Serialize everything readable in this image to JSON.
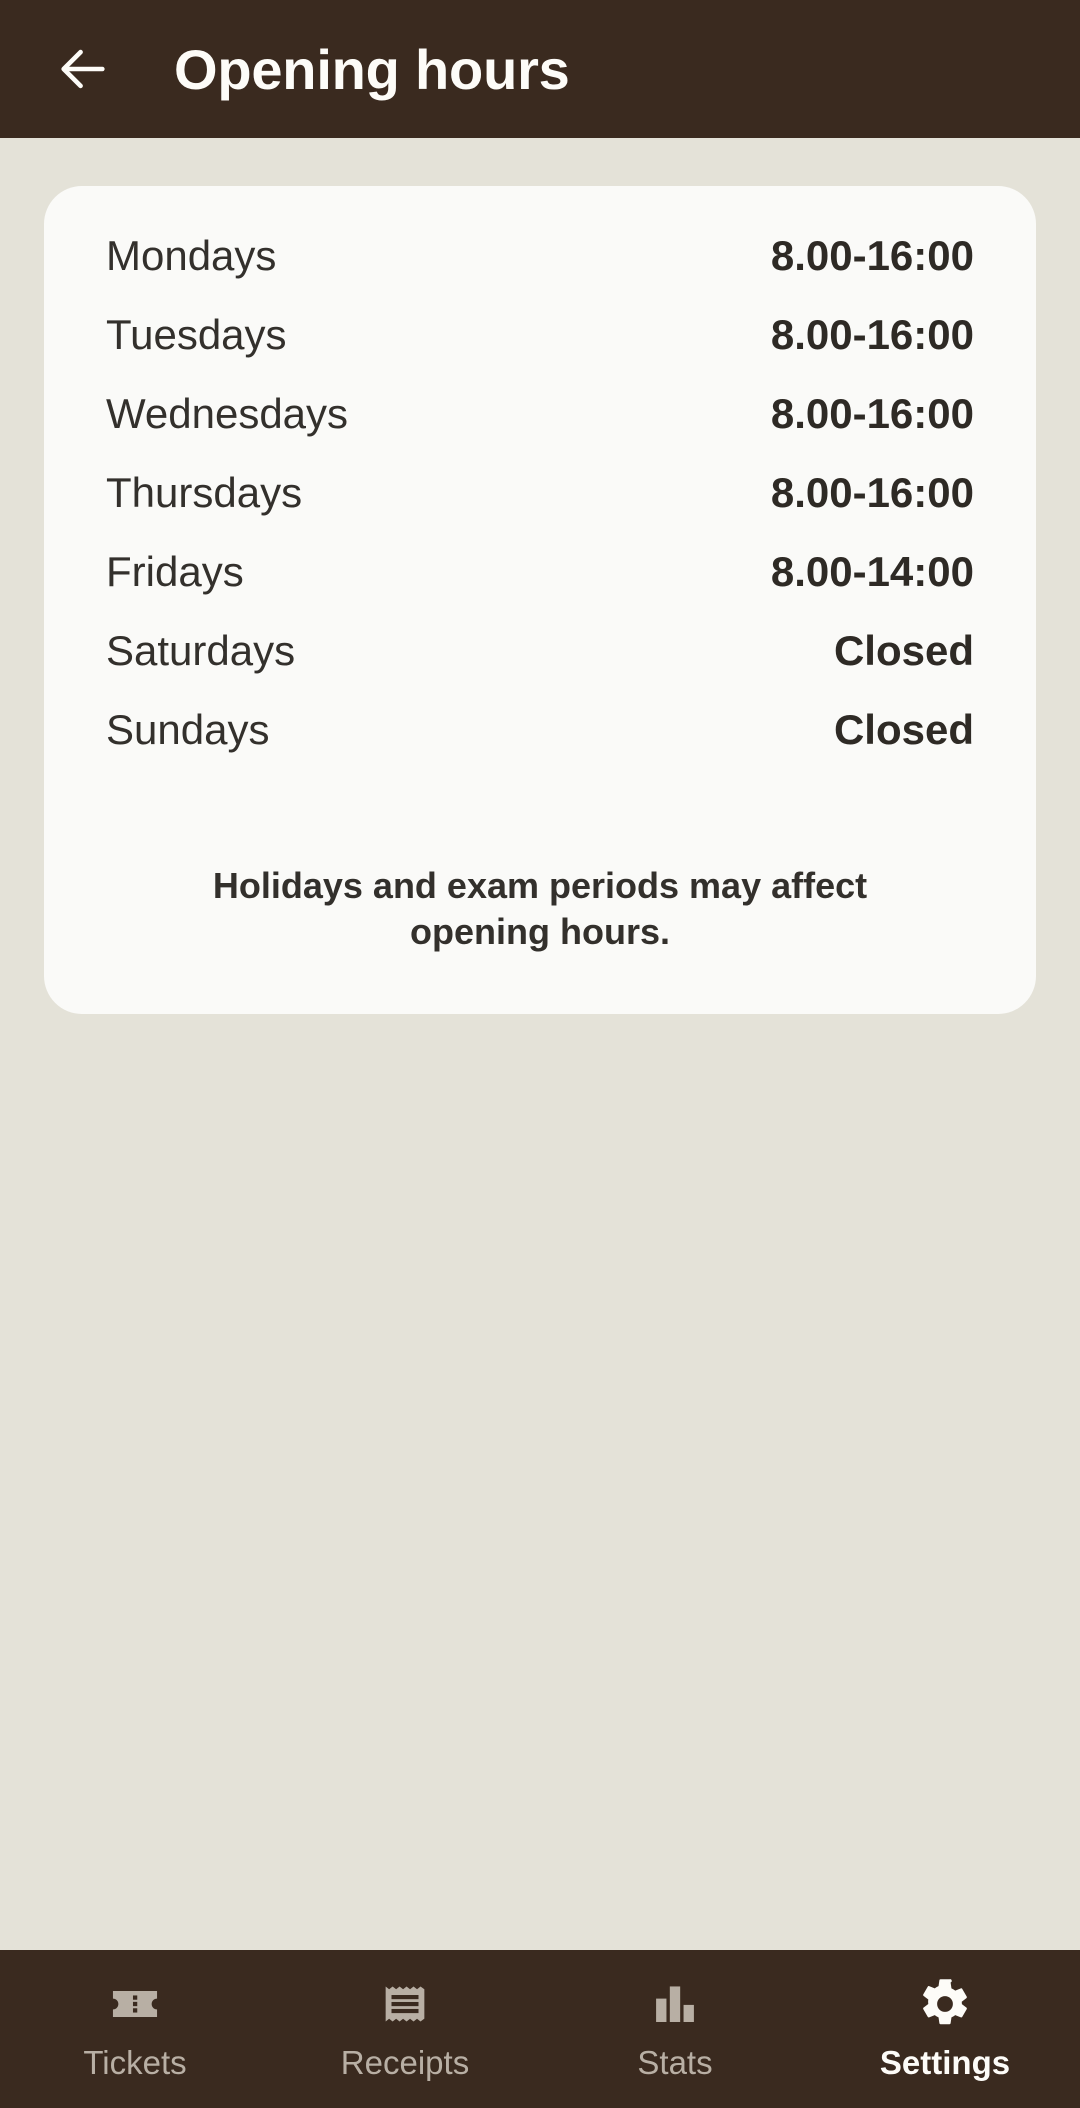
{
  "appbar": {
    "back_icon": "arrow-left-icon",
    "title": "Opening hours"
  },
  "card": {
    "rows": [
      {
        "day": "Mondays",
        "hours": "8.00-16:00"
      },
      {
        "day": "Tuesdays",
        "hours": "8.00-16:00"
      },
      {
        "day": "Wednesdays",
        "hours": "8.00-16:00"
      },
      {
        "day": "Thursdays",
        "hours": "8.00-16:00"
      },
      {
        "day": "Fridays",
        "hours": "8.00-14:00"
      },
      {
        "day": "Saturdays",
        "hours": "Closed"
      },
      {
        "day": "Sundays",
        "hours": "Closed"
      }
    ],
    "note": "Holidays and exam periods may affect opening hours."
  },
  "bottomnav": {
    "items": [
      {
        "label": "Tickets",
        "icon": "ticket-icon",
        "active": false
      },
      {
        "label": "Receipts",
        "icon": "receipt-icon",
        "active": false
      },
      {
        "label": "Stats",
        "icon": "bar-chart-icon",
        "active": false
      },
      {
        "label": "Settings",
        "icon": "gear-icon",
        "active": true
      }
    ]
  },
  "colors": {
    "page_background": "#e4e2d8",
    "appbar_background": "#3a2a1f",
    "card_background": "#fafaf8",
    "text_primary": "#33302c",
    "nav_inactive": "#b8afa4",
    "nav_active": "#fdfcf8"
  }
}
